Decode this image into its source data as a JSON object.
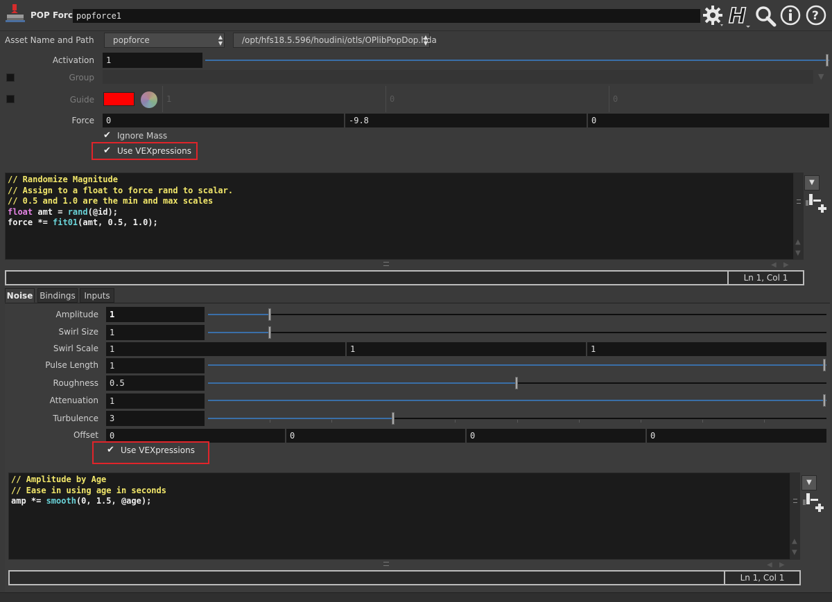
{
  "header": {
    "node_type": "POP Force",
    "node_name": "popforce1"
  },
  "asset": {
    "label": "Asset Name and Path",
    "name": "popforce",
    "path": "/opt/hfs18.5.596/houdini/otls/OPlibPopDop.hda"
  },
  "params": {
    "activation": {
      "label": "Activation",
      "value": "1",
      "level": 1.0
    },
    "group": {
      "label": "Group",
      "value": ""
    },
    "guide": {
      "label": "Guide",
      "color": "#ff0000",
      "v1": "1",
      "v2": "0",
      "v3": "0"
    },
    "force": {
      "label": "Force",
      "x": "0",
      "y": "-9.8",
      "z": "0"
    },
    "ignore_mass": {
      "label": "Ignore Mass",
      "checked": true
    },
    "use_vex": {
      "label": "Use VEXpressions",
      "checked": true
    }
  },
  "code1": {
    "line1": "// Randomize Magnitude",
    "line2": "// Assign to a float to force rand to scalar.",
    "line3": "// 0.5 and 1.0 are the min and max scales",
    "line4_kw": "float",
    "line4_rest1": " amt = ",
    "line4_fn": "rand",
    "line4_rest2": "(@id);",
    "line5_rest1": "force *= ",
    "line5_fn": "fit01",
    "line5_rest2": "(amt, 0.5, 1.0);",
    "status": "Ln 1, Col 1"
  },
  "tabs": [
    "Noise",
    "Bindings",
    "Inputs"
  ],
  "noise": {
    "amplitude": {
      "label": "Amplitude",
      "value": "1",
      "level": 0.1
    },
    "swirl_size": {
      "label": "Swirl Size",
      "value": "1",
      "level": 0.1
    },
    "swirl_scale": {
      "label": "Swirl Scale",
      "x": "1",
      "y": "1",
      "z": "1"
    },
    "pulse_length": {
      "label": "Pulse Length",
      "value": "1",
      "level": 1.0
    },
    "roughness": {
      "label": "Roughness",
      "value": "0.5",
      "level": 0.5
    },
    "attenuation": {
      "label": "Attenuation",
      "value": "1",
      "level": 1.0
    },
    "turbulence": {
      "label": "Turbulence",
      "value": "3",
      "level": 0.3
    },
    "offset": {
      "label": "Offset",
      "x": "0",
      "y": "0",
      "z": "0",
      "w": "0"
    },
    "use_vex": {
      "label": "Use VEXpressions",
      "checked": true
    }
  },
  "code2": {
    "line1": "// Amplitude by Age",
    "line2": "// Ease in using age in seconds",
    "line3_rest1": "amp *= ",
    "line3_fn": "smooth",
    "line3_rest2": "(0, 1.5, @age);",
    "status": "Ln 1, Col 1"
  },
  "icons": {
    "node": "pop-force-node-icon",
    "gear": "gear-icon",
    "help_h": "houdini-help-icon",
    "search": "search-icon",
    "info": "info-icon",
    "help": "help-icon"
  },
  "colors": {
    "background": "#3a3a3a",
    "field": "#151515",
    "slider_fill": "#3a6fa8",
    "highlight_box": "#e0242a",
    "comment": "#f2e76a",
    "keyword": "#e684e6",
    "function": "#6ad3d8"
  }
}
